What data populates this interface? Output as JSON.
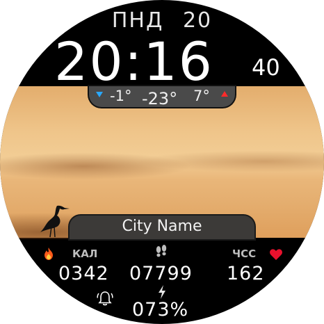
{
  "header": {
    "day": "ПНД",
    "date": "20"
  },
  "clock": {
    "time": "20:16",
    "seconds": "40"
  },
  "weather": {
    "min": "-1°",
    "current": "-23°",
    "max": "7°",
    "min_color": "#29a8ff",
    "max_color": "#ff2a2a"
  },
  "city": "City Name",
  "stats": {
    "calories_label": "КАЛ",
    "calories": "0342",
    "steps": "07799",
    "heart_label": "ЧСС",
    "heart_rate": "162",
    "battery": "073%"
  },
  "icons": {
    "calories": "flame-icon",
    "steps": "footprints-icon",
    "heart": "heart-icon",
    "alarm": "alarm-bell-icon",
    "battery": "lightning-icon"
  }
}
